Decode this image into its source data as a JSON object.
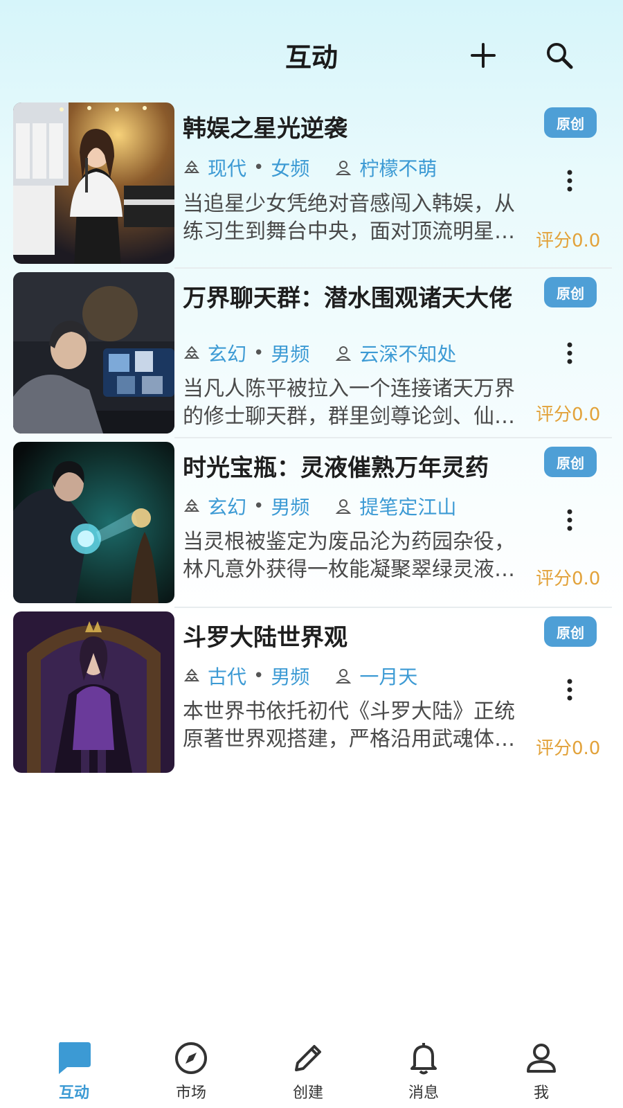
{
  "header": {
    "title": "互动",
    "add_icon": "plus-icon",
    "search_icon": "search-icon"
  },
  "cards": [
    {
      "title": "韩娱之星光逆袭",
      "badge": "原创",
      "genre": "现代",
      "channel": "女频",
      "author": "柠檬不萌",
      "description": "当追星少女凭绝对音感闯入韩娱，从练习生到舞台中央，面对顶流明星与残酷竞争……",
      "score": "评分0.0"
    },
    {
      "title": "万界聊天群：潜水围观诸天大佬",
      "badge": "原创",
      "genre": "玄幻",
      "channel": "男频",
      "author": "云深不知处",
      "description": "当凡人陈平被拉入一个连接诸天万界的修士聊天群，群里剑尊论剑、仙帝炼丹……",
      "score": "评分0.0"
    },
    {
      "title": "时光宝瓶：灵液催熟万年灵药",
      "badge": "原创",
      "genre": "玄幻",
      "channel": "男频",
      "author": "提笔定江山",
      "description": "当灵根被鉴定为废品沦为药园杂役，林凡意外获得一枚能凝聚翠绿灵液的时光宝瓶……",
      "score": "评分0.0"
    },
    {
      "title": "斗罗大陆世界观",
      "badge": "原创",
      "genre": "古代",
      "channel": "男频",
      "author": "一月天",
      "description": "本世界书依托初代《斗罗大陆》正统原著世界观搭建，严格沿用武魂体系与魂环设定……",
      "score": "评分0.0"
    }
  ],
  "tabbar": {
    "items": [
      {
        "label": "互动",
        "icon": "chat-bubble-icon",
        "active": true
      },
      {
        "label": "市场",
        "icon": "compass-icon",
        "active": false
      },
      {
        "label": "创建",
        "icon": "pencil-icon",
        "active": false
      },
      {
        "label": "消息",
        "icon": "bell-icon",
        "active": false
      },
      {
        "label": "我",
        "icon": "person-icon",
        "active": false
      }
    ]
  },
  "colors": {
    "accent": "#3c9ad4",
    "badge": "#4e9fd6",
    "score": "#e2a23a"
  }
}
